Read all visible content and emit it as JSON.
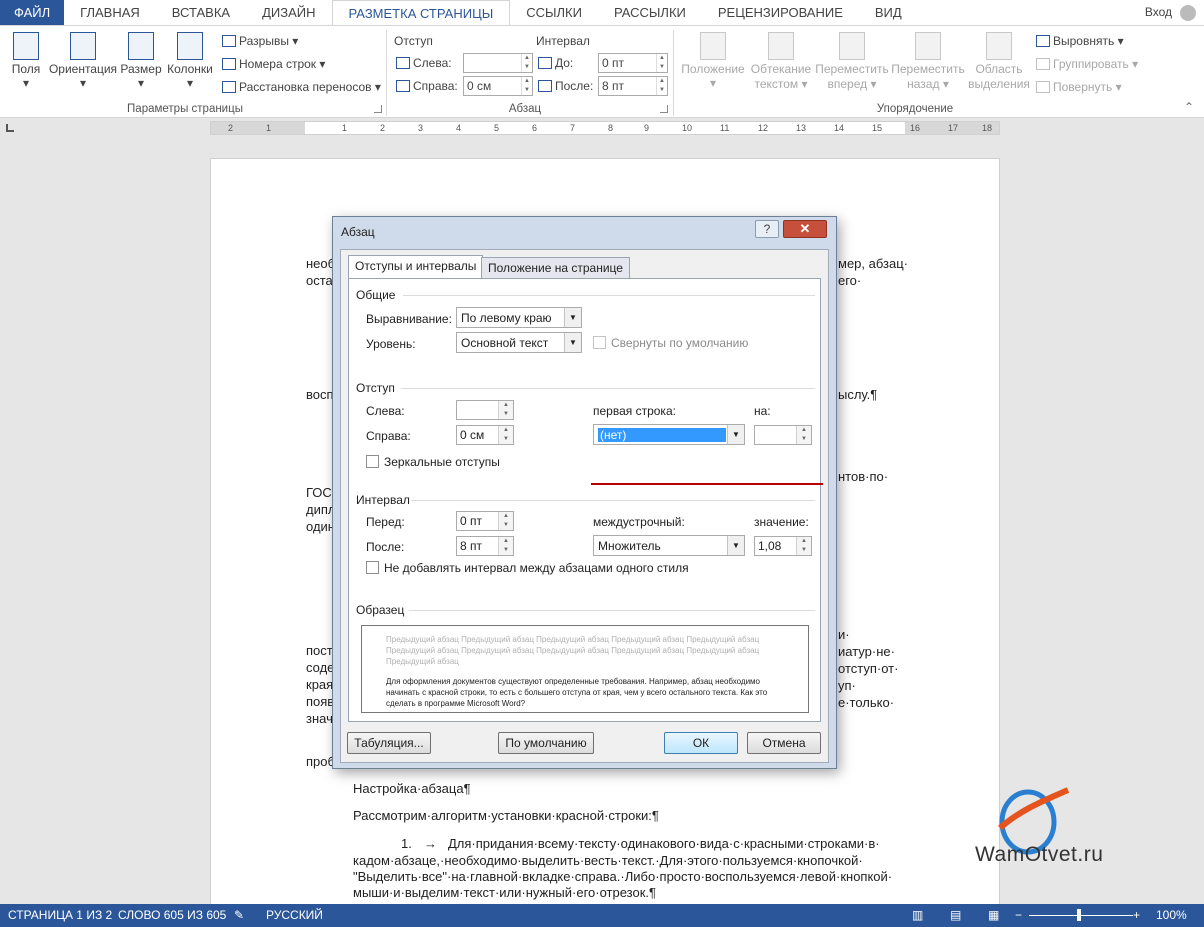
{
  "tabs": [
    "ФАЙЛ",
    "ГЛАВНАЯ",
    "ВСТАВКА",
    "ДИЗАЙН",
    "РАЗМЕТКА СТРАНИЦЫ",
    "ССЫЛКИ",
    "РАССЫЛКИ",
    "РЕЦЕНЗИРОВАНИЕ",
    "ВИД"
  ],
  "signin": "Вход",
  "ribbon": {
    "page_setup": {
      "buttons": [
        "Поля",
        "Ориентация",
        "Размер",
        "Колонки"
      ],
      "small": [
        "Разрывы",
        "Номера строк",
        "Расстановка переносов"
      ],
      "group_label": "Параметры страницы"
    },
    "paragraph": {
      "indent_header": "Отступ",
      "left_label": "Слева:",
      "left_value": "",
      "right_label": "Справа:",
      "right_value": "0 см",
      "spacing_header": "Интервал",
      "before_label": "До:",
      "before_value": "0 пт",
      "after_label": "После:",
      "after_value": "8 пт",
      "group_label": "Абзац"
    },
    "arrange": {
      "buttons": [
        "Положение",
        "Обтекание текстом",
        "Переместить вперед",
        "Переместить назад",
        "Область выделения"
      ],
      "small": [
        "Выровнять",
        "Группировать",
        "Повернуть"
      ],
      "group_label": "Упорядочение"
    }
  },
  "ruler": {
    "numbers": [
      "2",
      "1",
      "1",
      "2",
      "3",
      "4",
      "5",
      "6",
      "7",
      "8",
      "9",
      "10",
      "11",
      "12",
      "13",
      "14",
      "15",
      "16",
      "17",
      "18"
    ]
  },
  "document": {
    "fragments": [
      "необ",
      "оста",
      "мер, абзац·",
      "его·",
      "восп",
      "ыслу.¶",
      "ГОС",
      "дипл",
      "один",
      "нтов·по·",
      "",
      "пост",
      "соде",
      "края",
      "появ",
      "знач",
      "и·",
      "иатур·не·",
      "отступ·от·",
      "уп·",
      "е·только·",
      "проб"
    ],
    "heading": "Настройка·абзаца¶",
    "intro": "Рассмотрим·алгоритм·установки·красной·строки:¶",
    "list_number": "1.",
    "list_arrow": "→",
    "list_lines": [
      "Для·придания·всему·тексту·одинакового·вида·с·красными·строками·в·",
      "кадом·абзаце,·необходимо·выделить·весть·текст.·Для·этого·пользуемся·кнопочкой·",
      "\"Выделить·все\"·на·главной·вкладке·справа.·Либо·просто·воспользуемся·левой·кнопкой·",
      "мыши·и·выделим·текст·или·нужный·его·отрезок.¶"
    ]
  },
  "watermark": "WamOtvet.ru",
  "status": {
    "page": "СТРАНИЦА 1 ИЗ 2",
    "words": "СЛОВО 605 ИЗ 605",
    "language": "РУССКИЙ",
    "zoom": "100%",
    "zoom_fraction": 0.5
  },
  "dialog": {
    "title": "Абзац",
    "help": "?",
    "close": "✕",
    "tabs": [
      "Отступы и интервалы",
      "Положение на странице"
    ],
    "general": {
      "header": "Общие",
      "alignment_label": "Выравнивание:",
      "alignment_value": "По левому краю",
      "level_label": "Уровень:",
      "level_value": "Основной текст",
      "collapsed_label": "Свернуты по умолчанию"
    },
    "indent": {
      "header": "Отступ",
      "left_label": "Слева:",
      "left_value": "",
      "right_label": "Справа:",
      "right_value": "0 см",
      "first_line_label": "первая строка:",
      "first_line_value": "(нет)",
      "by_label": "на:",
      "by_value": "",
      "mirror_label": "Зеркальные отступы"
    },
    "spacing": {
      "header": "Интервал",
      "before_label": "Перед:",
      "before_value": "0 пт",
      "after_label": "После:",
      "after_value": "8 пт",
      "line_label": "междустрочный:",
      "line_value": "Множитель",
      "at_label": "значение:",
      "at_value": "1,08",
      "dont_add_label": "Не добавлять интервал между абзацами одного стиля"
    },
    "preview": {
      "header": "Образец",
      "prev_text": "Предыдущий абзац Предыдущий абзац Предыдущий абзац Предыдущий абзац Предыдущий абзац Предыдущий абзац Предыдущий абзац Предыдущий абзац Предыдущий абзац Предыдущий абзац Предыдущий абзац",
      "sample_text": "Для оформления документов существуют определенные требования. Например, абзац необходимо начинать с красной строки, то есть с большего отступа от края, чем у всего остального текста. Как это сделать в программе Microsoft Word?"
    },
    "buttons": {
      "tabs": "Табуляция...",
      "default": "По умолчанию",
      "ok": "ОК",
      "cancel": "Отмена"
    }
  }
}
